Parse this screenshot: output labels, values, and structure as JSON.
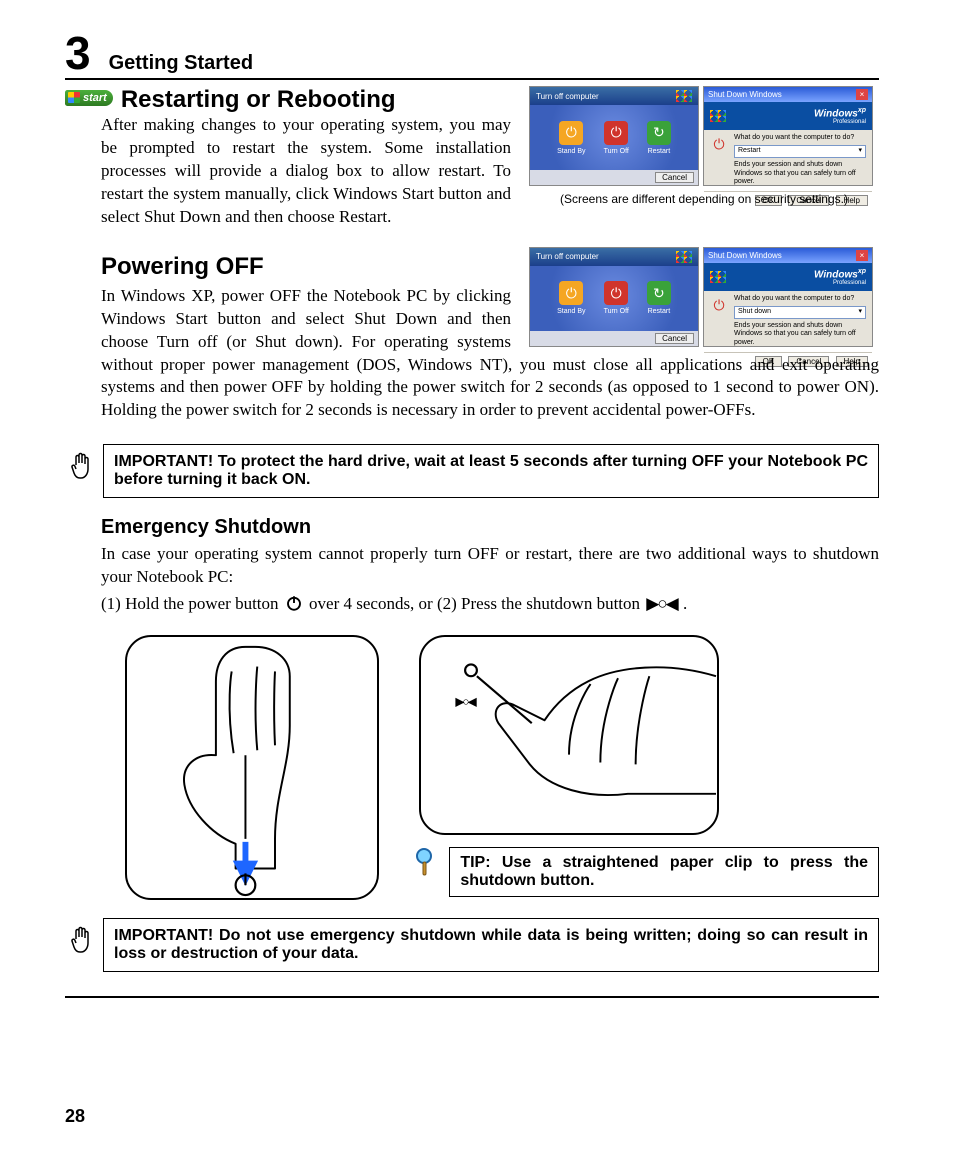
{
  "chapter": {
    "number": "3",
    "title": "Getting Started"
  },
  "start_badge": "start",
  "section1": {
    "heading": "Restarting or Rebooting",
    "body": "After making changes to your operating system, you may be prompted to restart the system. Some installation processes will provide a dialog box to allow restart. To restart the system manually, click Windows Start button and select Shut Down and then choose Restart.",
    "caption": "(Screens are different depending on security settings.)"
  },
  "turnoff_dialog": {
    "title": "Turn off computer",
    "buttons": [
      "Stand By",
      "Turn Off",
      "Restart"
    ],
    "cancel": "Cancel"
  },
  "shutdown_dialog": {
    "title": "Shut Down Windows",
    "brand": "Windows",
    "brand_suffix": "xp",
    "brand_sub": "Professional",
    "prompt": "What do you want the computer to do?",
    "option_a": "Restart",
    "desc_a": "Ends your session and shuts down Windows so that you can safely turn off power.",
    "option_b": "Shut down",
    "desc_b": "Ends your session and shuts down Windows so that you can safely turn off power.",
    "ok": "OK",
    "cancel": "Cancel",
    "help": "Help"
  },
  "section2": {
    "heading": "Powering OFF",
    "body": "In Windows XP, power OFF the Notebook PC by clicking Windows Start button and select Shut Down and then choose Turn off (or Shut down). For operating systems without proper power management (DOS, Windows NT), you must close all applications and exit operating systems and then power OFF by holding the power switch for 2 seconds (as opposed to 1 second to power ON). Holding the power switch for 2 seconds is necessary in order to prevent accidental power-OFFs."
  },
  "important1": "IMPORTANT!  To protect the hard drive, wait at least 5 seconds after turning OFF your Notebook PC before turning it back ON.",
  "section3": {
    "heading": "Emergency Shutdown",
    "intro": "In case your operating system cannot properly turn OFF or restart, there are two additional ways to shutdown your Notebook PC:",
    "step1_a": "(1) Hold the power button ",
    "step1_b": " over 4 seconds, or  (2) Press the shutdown button ",
    "step1_c": "."
  },
  "tip": "TIP: Use a straightened paper clip to press the shutdown button.",
  "important2": "IMPORTANT!  Do not use emergency shutdown while data is being written; doing so can result in loss or destruction of your data.",
  "page_number": "28",
  "inline_shutdown_glyph": "▶○◀"
}
